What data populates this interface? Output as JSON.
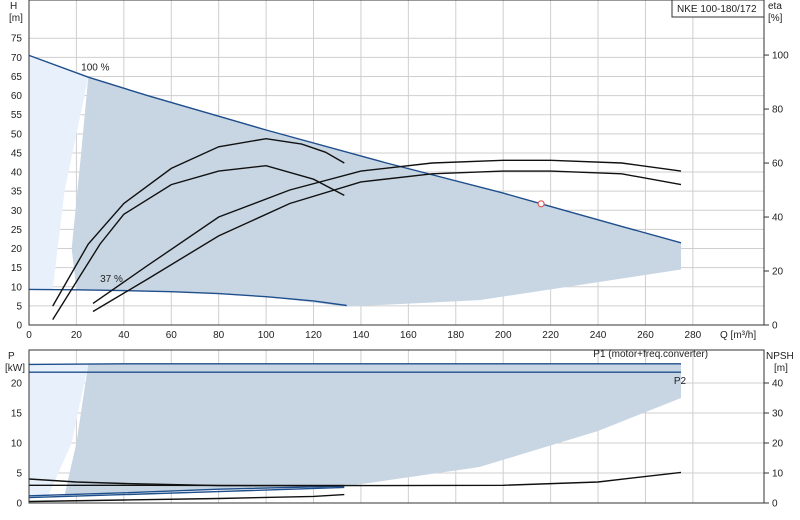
{
  "chart_data": [
    {
      "type": "line",
      "title": "NKE 100-180/172",
      "xlabel": "Q [m³/h]",
      "x_ticks": [
        0,
        20,
        40,
        60,
        80,
        100,
        120,
        140,
        160,
        180,
        200,
        220,
        240,
        260,
        280
      ],
      "xlim": [
        0,
        310
      ],
      "left_axis": {
        "label_top": "H",
        "label_unit": "[m]",
        "ylim": [
          0,
          85
        ],
        "ticks": [
          0,
          5,
          10,
          15,
          20,
          25,
          30,
          35,
          40,
          45,
          50,
          55,
          60,
          65,
          70,
          75
        ]
      },
      "right_axis": {
        "label_top": "eta",
        "label_unit": "[%]",
        "ylim": [
          0,
          120.4
        ],
        "ticks": [
          0,
          20,
          40,
          60,
          80,
          100
        ]
      },
      "grid": true,
      "annotations": [
        {
          "text": "100 %",
          "x": 22,
          "y": 66.5
        },
        {
          "text": "37 %",
          "x": 30,
          "y": 11.3
        }
      ],
      "series": [
        {
          "role": "head_max",
          "axis": "left",
          "color": "#1f4e8c",
          "x": [
            0,
            25,
            50,
            100,
            150,
            200,
            216,
            250,
            275
          ],
          "y": [
            70.5,
            64.8,
            60,
            51,
            42.5,
            34.5,
            31.7,
            25.8,
            21.5
          ]
        },
        {
          "role": "head_min",
          "axis": "left",
          "color": "#1f4e8c",
          "x": [
            0,
            20,
            40,
            60,
            80,
            100,
            120,
            134
          ],
          "y": [
            9.3,
            9.2,
            9.0,
            8.7,
            8.2,
            7.4,
            6.3,
            5.1
          ]
        },
        {
          "role": "eta_high_low_left",
          "axis": "right",
          "color": "#111111",
          "x": [
            10,
            25,
            40,
            60,
            80,
            100,
            115,
            125,
            133
          ],
          "y": [
            7,
            30,
            45,
            58,
            66,
            69,
            67,
            64,
            60
          ]
        },
        {
          "role": "eta_low_left",
          "axis": "right",
          "color": "#111111",
          "x": [
            10,
            20,
            30,
            40,
            60,
            80,
            100,
            120,
            133
          ],
          "y": [
            2,
            16,
            30,
            41,
            52,
            57,
            59,
            54,
            48
          ]
        },
        {
          "role": "eta_high_right",
          "axis": "right",
          "color": "#111111",
          "x": [
            27,
            50,
            80,
            110,
            140,
            170,
            200,
            220,
            250,
            275
          ],
          "y": [
            8,
            22,
            40,
            50,
            57,
            60,
            61,
            61,
            60,
            57
          ]
        },
        {
          "role": "eta_low_right",
          "axis": "right",
          "color": "#111111",
          "x": [
            27,
            50,
            80,
            110,
            140,
            170,
            200,
            220,
            250,
            275
          ],
          "y": [
            5,
            17,
            33,
            45,
            53,
            56,
            57,
            57,
            56,
            52
          ]
        }
      ],
      "op_point": {
        "x": 216,
        "y": 31.7,
        "color": "#e06060"
      }
    },
    {
      "type": "line",
      "xlim": [
        0,
        310
      ],
      "left_axis": {
        "label_top": "P",
        "label_unit": "[kW]",
        "ylim": [
          0,
          25.5
        ],
        "ticks": [
          0,
          5,
          10,
          15,
          20
        ]
      },
      "right_axis": {
        "label_top": "NPSH",
        "label_unit": "[m]",
        "ylim": [
          0,
          51
        ],
        "ticks": [
          0,
          10,
          20,
          30,
          40
        ]
      },
      "grid": true,
      "labels": [
        {
          "text": "P1 (motor+freq.converter)",
          "x": 238,
          "y": 24.3
        },
        {
          "text": "P2",
          "x": 272,
          "y": 19.8
        }
      ],
      "series": [
        {
          "role": "P1_max",
          "axis": "left",
          "color": "#1f4e8c",
          "x": [
            0,
            40,
            100,
            200,
            275
          ],
          "y": [
            23.1,
            23.2,
            23.2,
            23.2,
            23.2
          ]
        },
        {
          "role": "P2_max",
          "axis": "left",
          "color": "#1f4e8c",
          "x": [
            0,
            40,
            100,
            200,
            275
          ],
          "y": [
            21.8,
            21.8,
            21.8,
            21.8,
            21.8
          ]
        },
        {
          "role": "P1_min",
          "axis": "left",
          "color": "#1f4e8c",
          "x": [
            0,
            40,
            80,
            133
          ],
          "y": [
            1.2,
            1.7,
            2.3,
            2.8
          ]
        },
        {
          "role": "P2_min",
          "axis": "left",
          "color": "#1f4e8c",
          "x": [
            0,
            40,
            80,
            133
          ],
          "y": [
            0.9,
            1.4,
            1.9,
            2.6
          ]
        },
        {
          "role": "NPSH_left",
          "axis": "right",
          "color": "#111111",
          "x": [
            0,
            20,
            40,
            80,
            120,
            133
          ],
          "y": [
            8,
            7,
            6.5,
            5.8,
            5.8,
            5.8
          ]
        },
        {
          "role": "NPSH_left_low",
          "axis": "right",
          "color": "#111111",
          "x": [
            0,
            40,
            80,
            120,
            133
          ],
          "y": [
            0.5,
            1,
            1.5,
            2.2,
            2.8
          ]
        },
        {
          "role": "NPSH_right",
          "axis": "right",
          "color": "#111111",
          "x": [
            0,
            50,
            100,
            150,
            200,
            240,
            275
          ],
          "y": [
            5.9,
            5.9,
            5.8,
            5.8,
            5.9,
            7,
            10.2
          ]
        }
      ]
    }
  ],
  "colors": {
    "axis": "#333333",
    "grid": "#cfcfcf",
    "area_dark": "#c8d6e4",
    "area_light": "#e8f1fb",
    "curve_blue": "#1f4e8c"
  }
}
